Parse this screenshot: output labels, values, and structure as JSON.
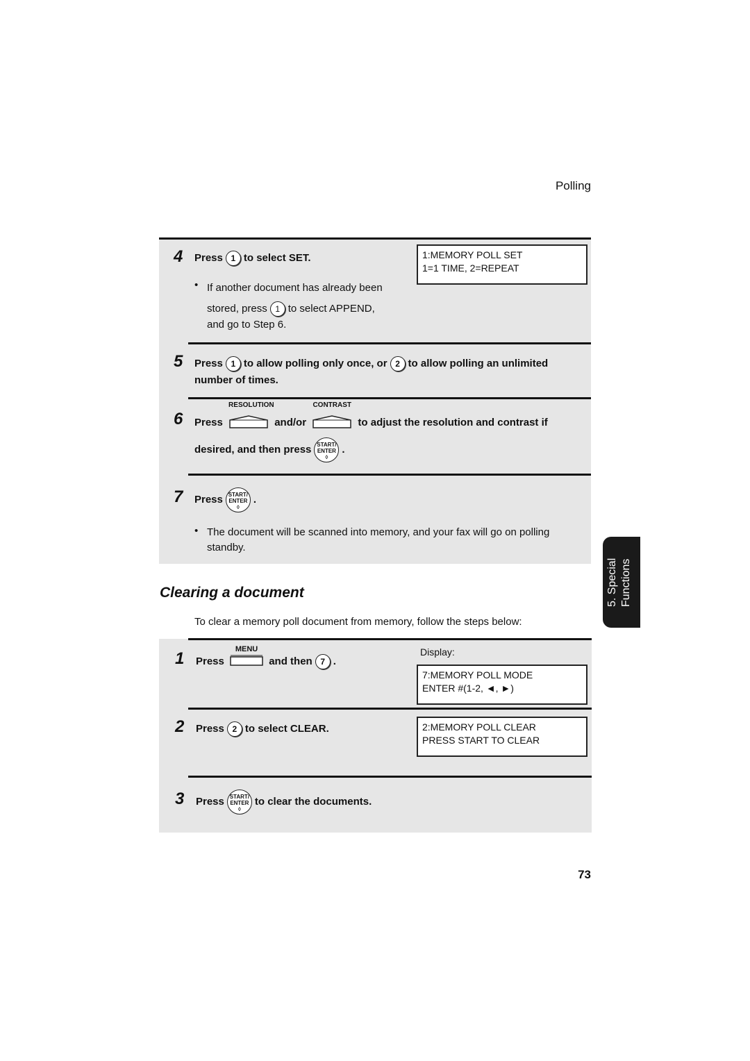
{
  "header": {
    "section": "Polling"
  },
  "steps_top": [
    {
      "num": "4",
      "pre": "Press",
      "key": "1",
      "post": "to select SET.",
      "bullet_a": "If another document has already been",
      "bullet_b1": "stored, press",
      "bullet_key": "1",
      "bullet_b2": "to select APPEND,",
      "bullet_c": "and go to Step 6.",
      "display": [
        "1:MEMORY POLL SET",
        "1=1 TIME, 2=REPEAT"
      ]
    },
    {
      "num": "5",
      "pre": "Press",
      "key1": "1",
      "mid": "to allow polling only once, or",
      "key2": "2",
      "post": "to allow polling an unlimited",
      "line2": "number of times."
    },
    {
      "num": "6",
      "pre": "Press",
      "key1": "RESOLUTION",
      "mid": "and/or",
      "key2": "CONTRAST",
      "post": "to adjust the resolution and contrast if",
      "line2": "desired, and then press",
      "end": "."
    },
    {
      "num": "7",
      "pre": "Press",
      "end": ".",
      "bullet": "The document will be scanned into memory, and your fax will go on polling",
      "bullet2": "standby."
    }
  ],
  "start_key": {
    "l1": "START/",
    "l2": "ENTER",
    "l3": "◊"
  },
  "section_title": "Clearing a document",
  "intro": "To clear a memory poll document from memory, follow the steps below:",
  "steps_bottom": [
    {
      "num": "1",
      "pre": "Press",
      "key": "MENU",
      "mid": "and then",
      "key2": "7",
      "end": ".",
      "display_label": "Display:",
      "display": [
        "7:MEMORY POLL MODE",
        "ENTER #(1-2, ◄, ►)"
      ]
    },
    {
      "num": "2",
      "pre": "Press",
      "key": "2",
      "post": "to select CLEAR.",
      "display": [
        "2:MEMORY POLL CLEAR",
        "PRESS START TO CLEAR"
      ]
    },
    {
      "num": "3",
      "pre": "Press",
      "post": "to clear the documents."
    }
  ],
  "side_tab": {
    "line1": "5. Special",
    "line2": "Functions"
  },
  "page_number": "73"
}
